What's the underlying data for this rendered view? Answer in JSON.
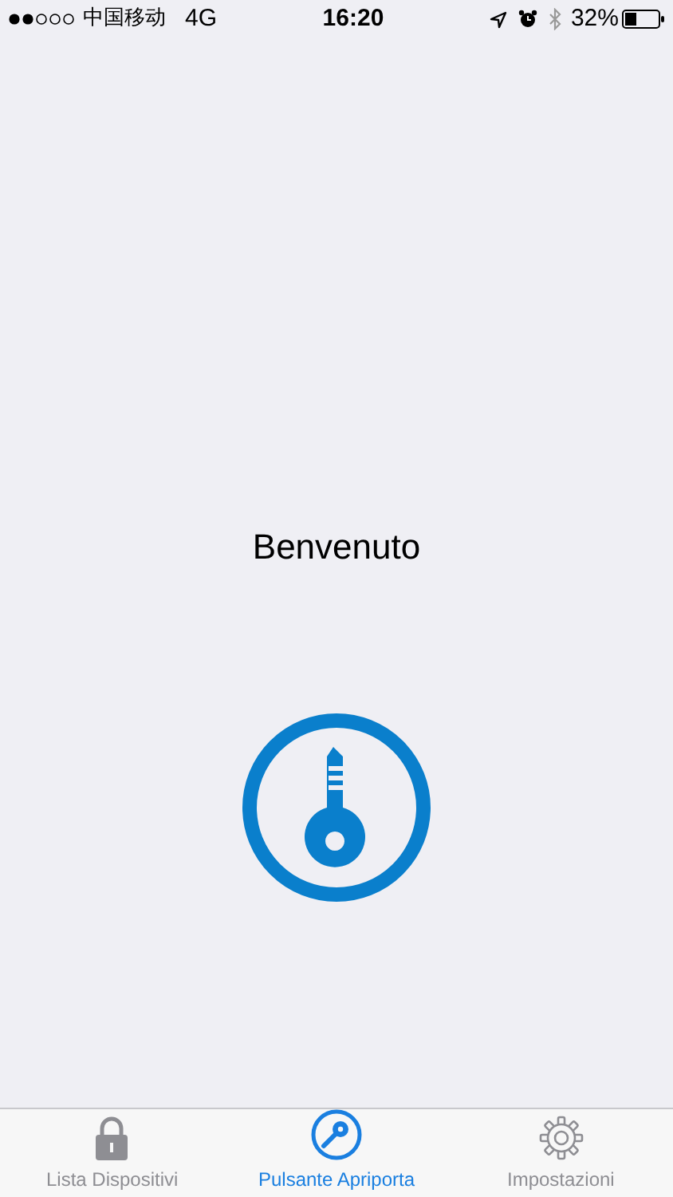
{
  "status_bar": {
    "carrier": "中国移动",
    "network": "4G",
    "time": "16:20",
    "battery": "32%"
  },
  "welcome": "Benvenuto",
  "tabs": [
    {
      "label": "Lista Dispositivi",
      "kind": "lock",
      "selected": false
    },
    {
      "label": "Pulsante Apriporta",
      "kind": "key",
      "selected": true
    },
    {
      "label": "Impostazioni",
      "kind": "gear",
      "selected": false
    }
  ]
}
